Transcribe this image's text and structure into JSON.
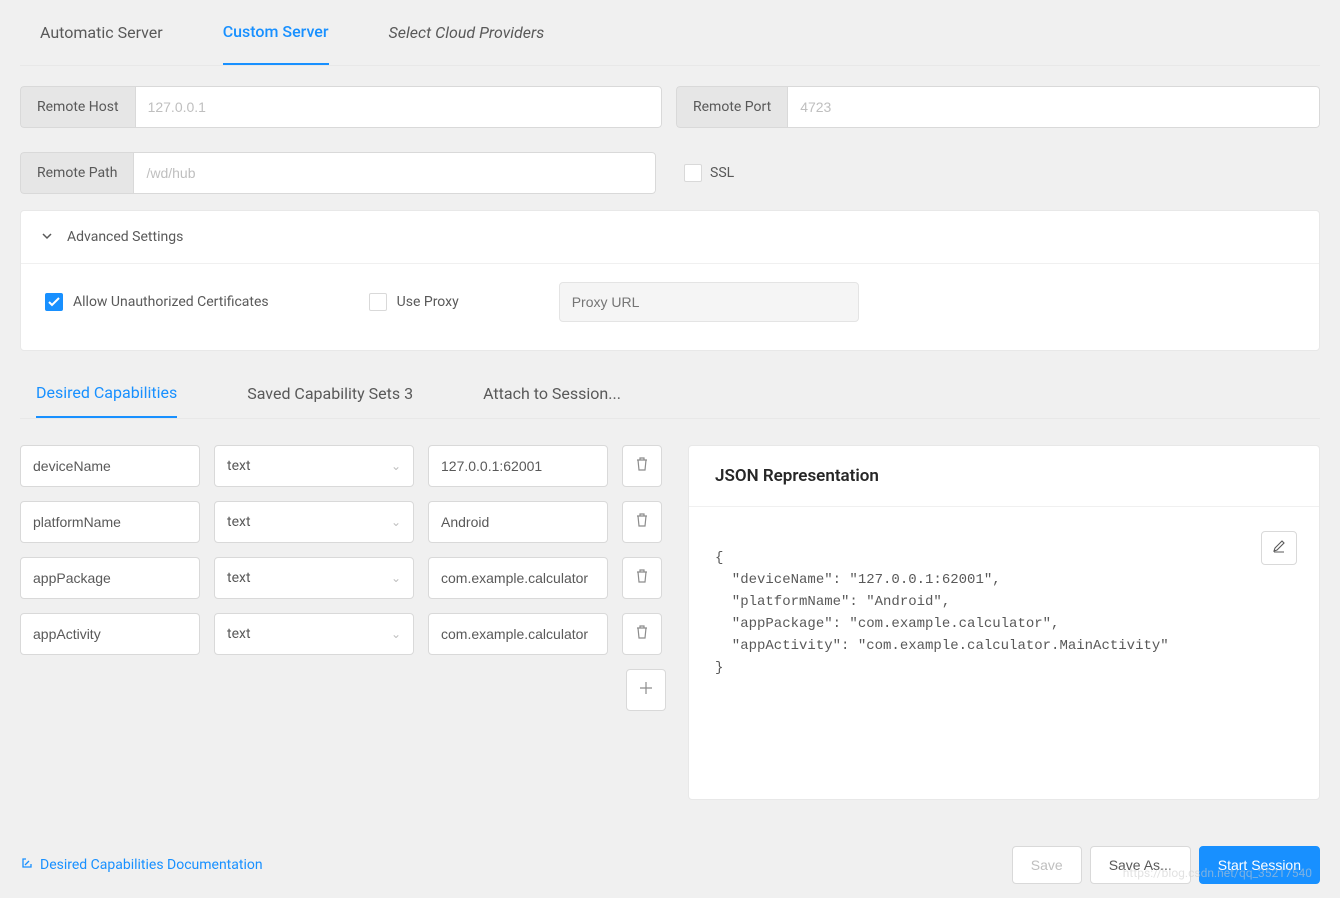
{
  "tabs": {
    "automatic": "Automatic Server",
    "custom": "Custom Server",
    "providers": "Select Cloud Providers"
  },
  "remote": {
    "host_label": "Remote Host",
    "host_placeholder": "127.0.0.1",
    "port_label": "Remote Port",
    "port_placeholder": "4723",
    "path_label": "Remote Path",
    "path_placeholder": "/wd/hub",
    "ssl_label": "SSL"
  },
  "advanced": {
    "title": "Advanced Settings",
    "allow_unauth": "Allow Unauthorized Certificates",
    "use_proxy": "Use Proxy",
    "proxy_placeholder": "Proxy URL"
  },
  "cap_tabs": {
    "desired": "Desired Capabilities",
    "saved": "Saved Capability Sets 3",
    "attach": "Attach to Session..."
  },
  "caps": [
    {
      "name": "deviceName",
      "type": "text",
      "value": "127.0.0.1:62001"
    },
    {
      "name": "platformName",
      "type": "text",
      "value": "Android"
    },
    {
      "name": "appPackage",
      "type": "text",
      "value": "com.example.calculator"
    },
    {
      "name": "appActivity",
      "type": "text",
      "value": "com.example.calculator"
    }
  ],
  "json": {
    "title": "JSON Representation",
    "body": "{\n  \"deviceName\": \"127.0.0.1:62001\",\n  \"platformName\": \"Android\",\n  \"appPackage\": \"com.example.calculator\",\n  \"appActivity\": \"com.example.calculator.MainActivity\"\n}"
  },
  "footer": {
    "doc_link": "Desired Capabilities Documentation",
    "save": "Save",
    "save_as": "Save As...",
    "start": "Start Session"
  },
  "watermark": "https://blog.csdn.net/qq_35217540"
}
